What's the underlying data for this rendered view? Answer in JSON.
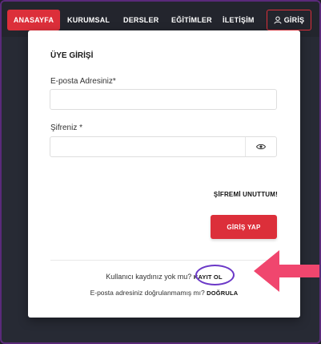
{
  "nav": {
    "home": "ANASAYFA",
    "corporate": "KURUMSAL",
    "lessons": "DERSLER",
    "trainings": "EĞİTİMLER",
    "contact": "İLETİŞİM",
    "login": "GİRİŞ"
  },
  "modal": {
    "title": "ÜYE GİRİŞİ",
    "email_label": "E-posta Adresiniz*",
    "password_label": "Şifreniz *",
    "forgot": "ŞİFREMİ UNUTTUM!",
    "login_button": "GİRİŞ YAP",
    "no_account_text": "Kullanıcı kaydınız yok mu?",
    "register_link": "KAYIT OL",
    "not_verified_text": "E-posta adresiniz doğrulanmamış mı?",
    "verify_link": "DOĞRULA"
  },
  "colors": {
    "accent": "#dc2f3a",
    "background": "#272a34",
    "annotation_circle": "#6b38c7",
    "annotation_arrow": "#f0466e"
  },
  "icons": {
    "login": "user-icon",
    "password_toggle": "eye-icon",
    "annotation": "arrow-left-icon"
  }
}
